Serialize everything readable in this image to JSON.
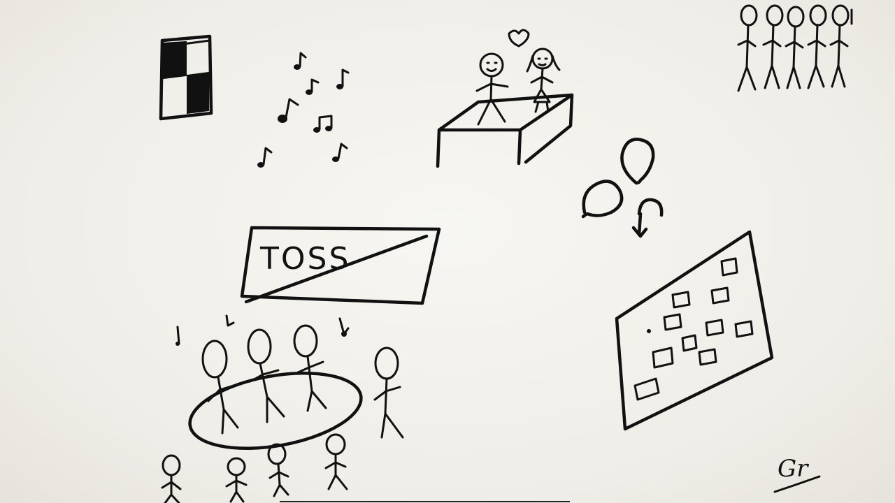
{
  "scene": {
    "sign_label": "TOSS",
    "artist_signature": "Gr",
    "ink_color": "#111111",
    "paper_color": "#f3f1ec"
  },
  "icons": [
    "speaker-icon",
    "music-notes-icon",
    "dancing-couple-on-stage-icon",
    "queue-of-people-icon",
    "speech-bubbles-icon",
    "sticky-note-board-icon",
    "crossed-out-toss-sign-icon",
    "people-around-table-icon"
  ]
}
